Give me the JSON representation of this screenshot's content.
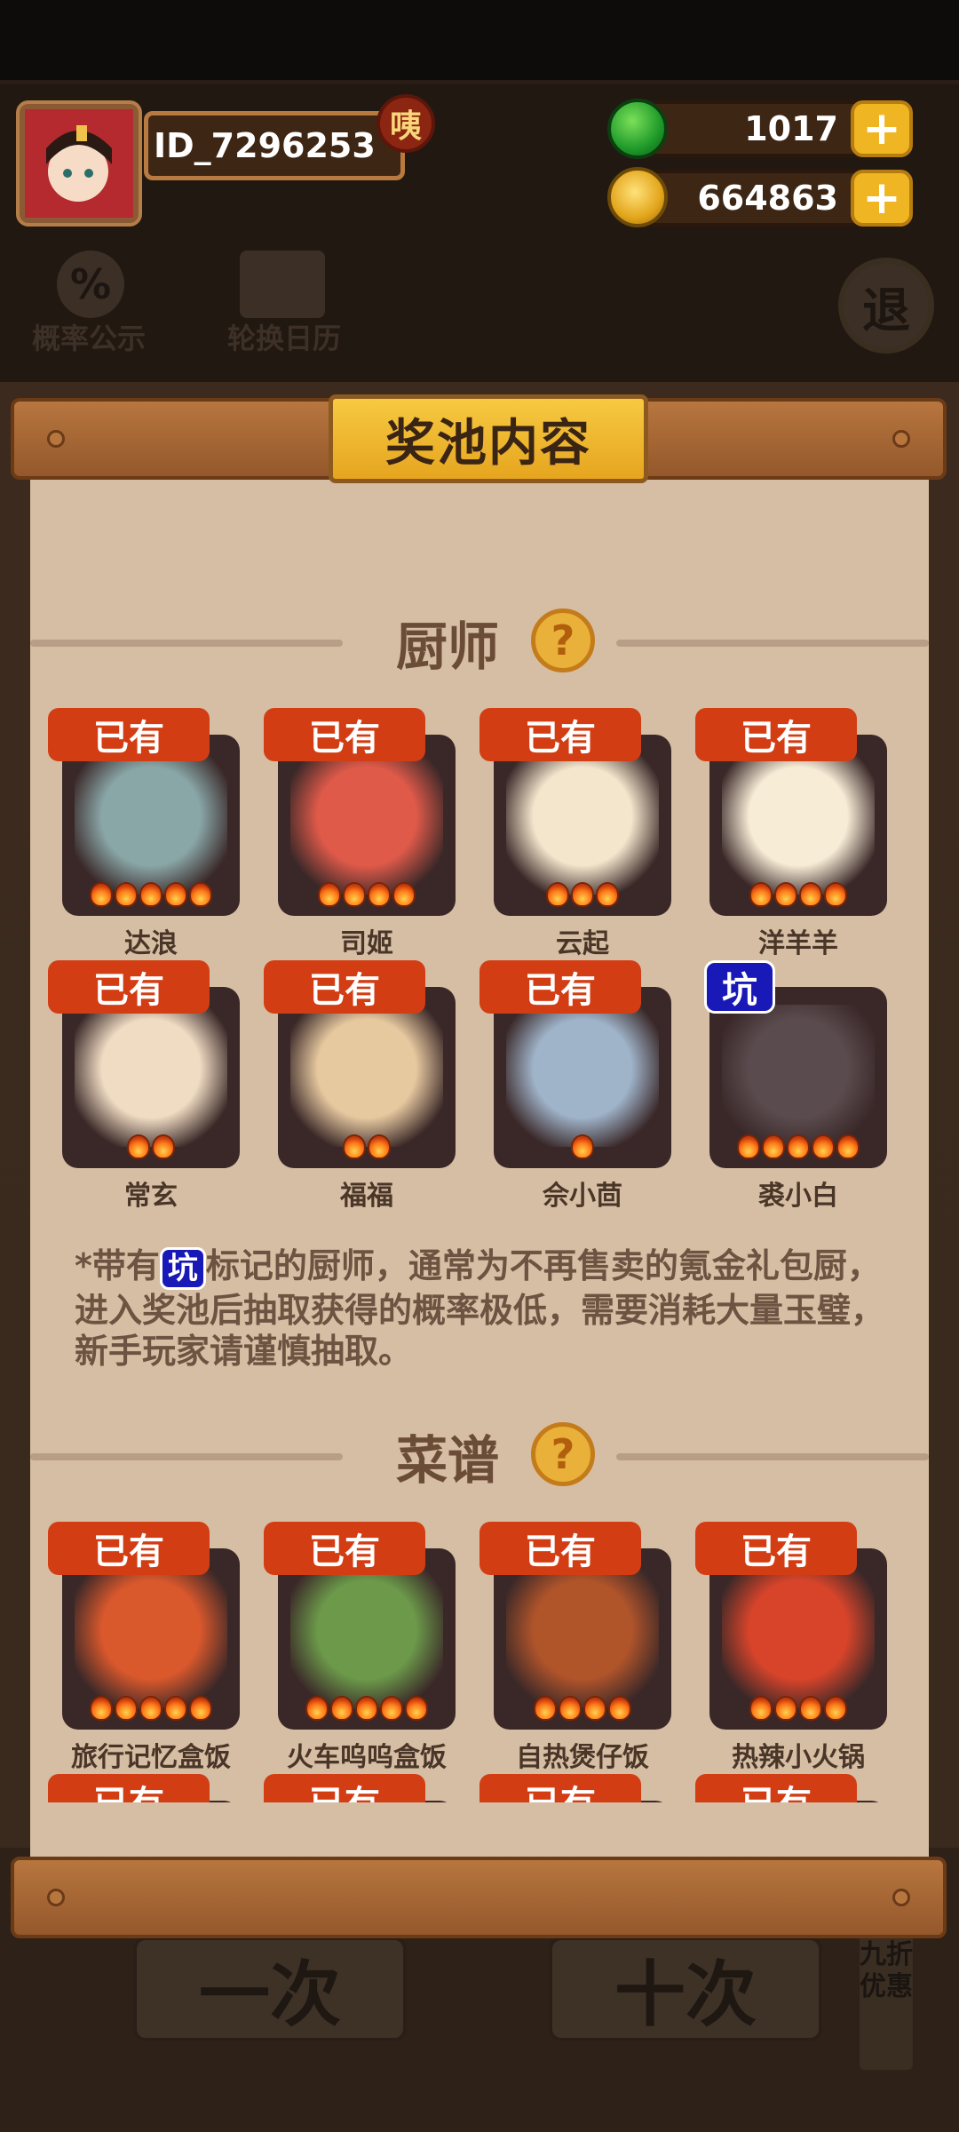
{
  "player": {
    "id": "ID_7296253",
    "badge": "咦",
    "avatar_label": "player avatar"
  },
  "resources": {
    "jade": "1017",
    "coins": "664863"
  },
  "background": {
    "probability_label": "概率公示",
    "probability_icon": "%",
    "calendar_label": "轮换日历",
    "exit_label": "退",
    "single_draw": "一次",
    "ten_draw": "十次",
    "discount": "九折优惠"
  },
  "modal": {
    "title": "奖池内容",
    "chef_section": "厨师",
    "recipe_section": "菜谱",
    "help_glyph": "?",
    "note_prefix": "*带有",
    "note_pit": "坑",
    "note_suffix": "标记的厨师，通常为不再售卖的氪金礼包厨，进入奖池后抽取获得的概率极低，需要消耗大量玉璧，新手玩家请谨慎抽取。"
  },
  "chefs": [
    {
      "name": "达浪",
      "badge": "已有",
      "flames": 5,
      "color": "#8aa7a8"
    },
    {
      "name": "司姬",
      "badge": "已有",
      "flames": 4,
      "color": "#e05a4a"
    },
    {
      "name": "云起",
      "badge": "已有",
      "flames": 3,
      "color": "#f3e6cc"
    },
    {
      "name": "洋羊羊",
      "badge": "已有",
      "flames": 4,
      "color": "#f7ecd6"
    },
    {
      "name": "常玄",
      "badge": "已有",
      "flames": 2,
      "color": "#f0dcc3"
    },
    {
      "name": "福福",
      "badge": "已有",
      "flames": 2,
      "color": "#e7c9a0"
    },
    {
      "name": "佘小茴",
      "badge": "已有",
      "flames": 1,
      "color": "#9fb3c9"
    },
    {
      "name": "裘小白",
      "badge": "坑",
      "flames": 5,
      "color": "#5a4b4e"
    }
  ],
  "recipes": [
    {
      "name": "旅行记忆盒饭",
      "badge": "已有",
      "flames": 5,
      "color": "#d9582c"
    },
    {
      "name": "火车呜呜盒饭",
      "badge": "已有",
      "flames": 5,
      "color": "#6c9a4a"
    },
    {
      "name": "自热煲仔饭",
      "badge": "已有",
      "flames": 4,
      "color": "#b0542a"
    },
    {
      "name": "热辣小火锅",
      "badge": "已有",
      "flames": 4,
      "color": "#d8442a"
    },
    {
      "name": "",
      "badge": "已有",
      "flames": 0,
      "color": "#3a2828"
    },
    {
      "name": "",
      "badge": "已有",
      "flames": 0,
      "color": "#3a2828"
    },
    {
      "name": "",
      "badge": "已有",
      "flames": 0,
      "color": "#3a2828"
    },
    {
      "name": "",
      "badge": "已有",
      "flames": 0,
      "color": "#3a2828"
    }
  ]
}
